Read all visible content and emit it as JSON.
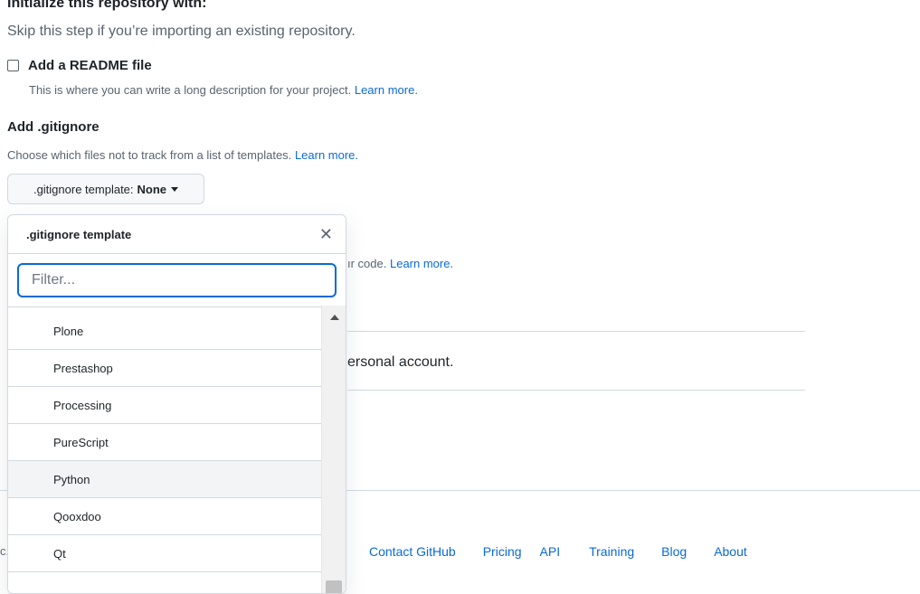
{
  "initialize": {
    "heading": "Initialize this repository with:",
    "subtext": "Skip this step if you’re importing an existing repository."
  },
  "readme": {
    "checked": false,
    "label": "Add a README file",
    "description": "This is where you can write a long description for your project.",
    "learn_more": "Learn more."
  },
  "gitignore": {
    "heading": "Add .gitignore",
    "description": "Choose which files not to track from a list of templates.",
    "learn_more": "Learn more.",
    "button_prefix": ".gitignore template:",
    "button_value": "None"
  },
  "popover": {
    "title": ".gitignore template",
    "close_glyph": "✕",
    "filter_placeholder": "Filter...",
    "items": [
      "Plone",
      "Prestashop",
      "Processing",
      "PureScript",
      "Python",
      "Qooxdoo",
      "Qt"
    ],
    "hovered_item": "Python"
  },
  "background": {
    "license_partial": "ır code.",
    "license_learn_more": "Learn more.",
    "personal_partial": "ersonal account.",
    "footer_fragment": "c."
  },
  "footer": {
    "links": [
      "Contact GitHub",
      "Pricing",
      "API",
      "Training",
      "Blog",
      "About"
    ]
  },
  "colors": {
    "link": "#0969da",
    "focus_border": "#0969da",
    "border": "#d1d9e0",
    "muted_text": "#59636e"
  }
}
